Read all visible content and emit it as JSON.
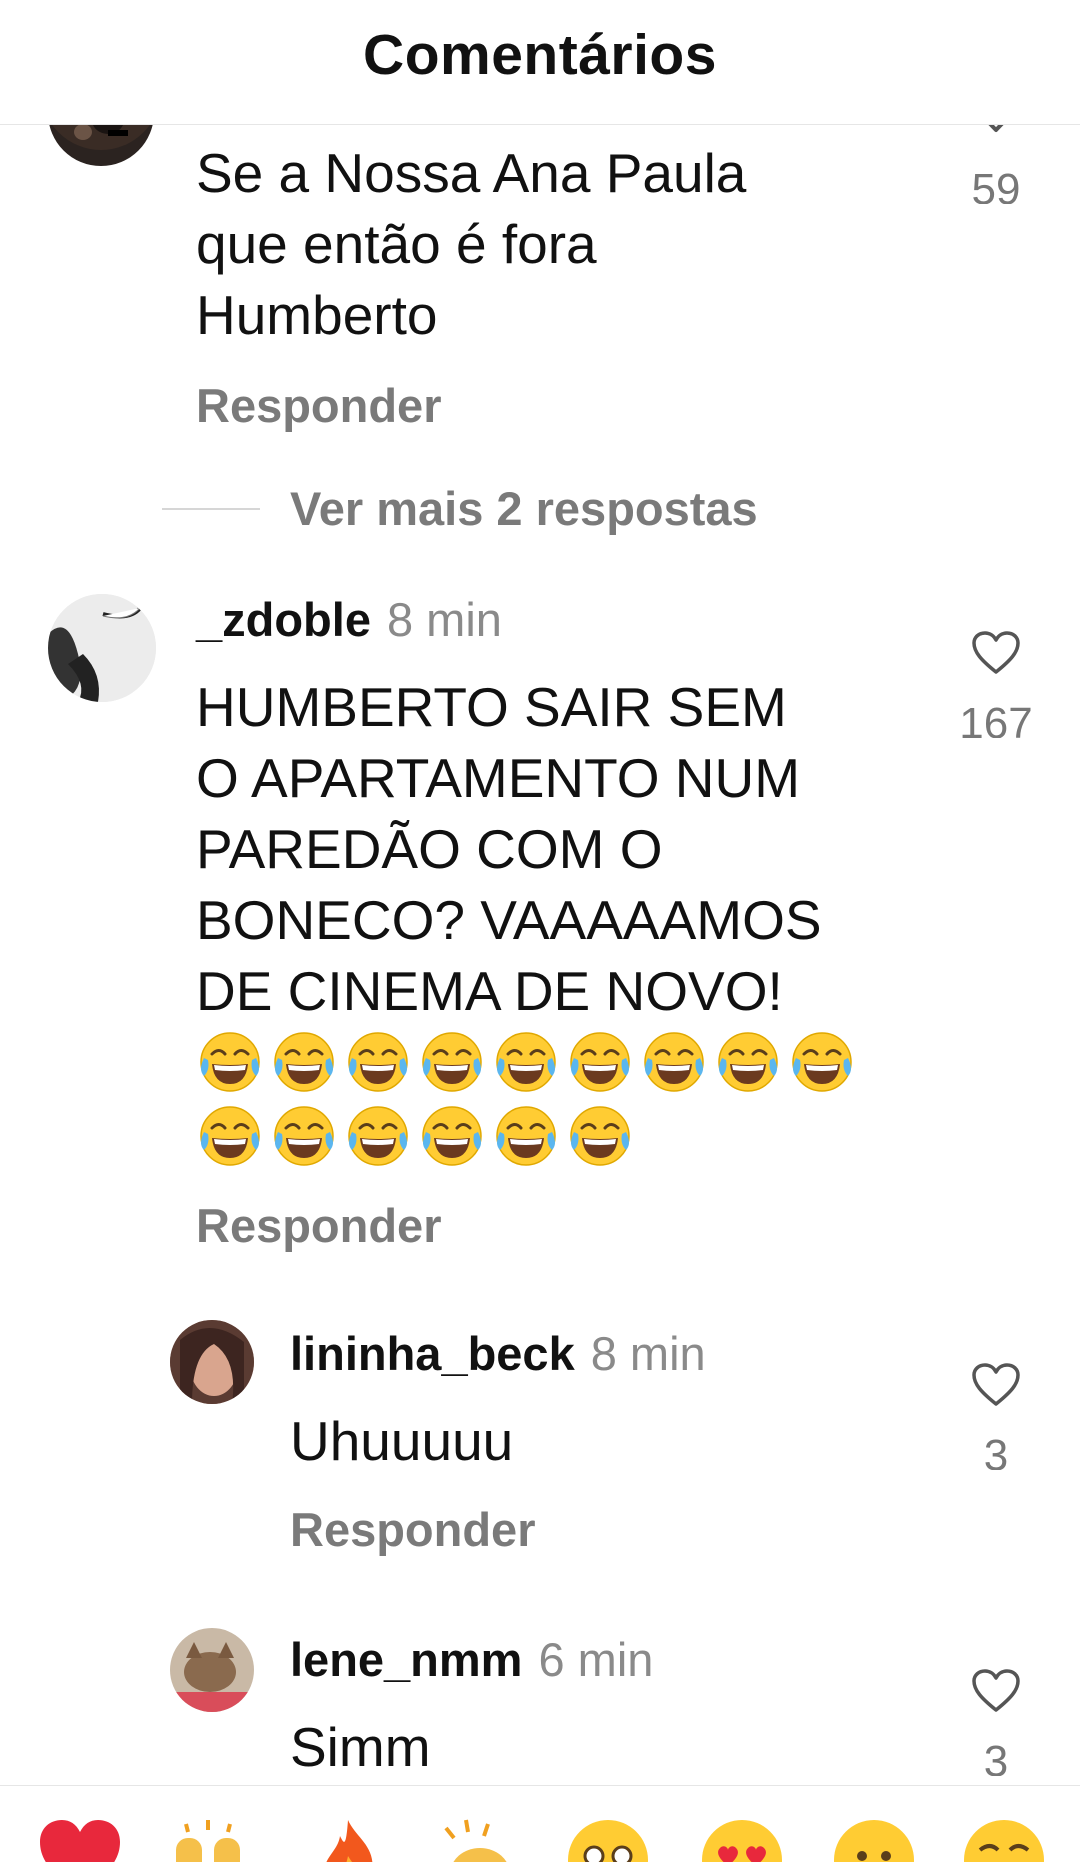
{
  "header": {
    "title": "Comentários"
  },
  "comments": [
    {
      "text_lines": [
        "Se a Nossa Ana Paula",
        "que então é fora",
        "Humberto"
      ],
      "likes": "59",
      "reply_label": "Responder"
    },
    {
      "username": "_zdoble",
      "time": "8 min",
      "text_lines": [
        "HUMBERTO SAIR SEM",
        "O APARTAMENTO NUM",
        "PAREDÃO COM O",
        "BONECO? VAAAAAMOS",
        "DE CINEMA DE NOVO!"
      ],
      "emoji_rows": [
        9,
        6
      ],
      "emoji_name": "face-with-tears-of-joy",
      "likes": "167",
      "reply_label": "Responder"
    },
    {
      "username": "lininha_beck",
      "time": "8 min",
      "text": "Uhuuuuu",
      "likes": "3",
      "reply_label": "Responder"
    },
    {
      "username": "lene_nmm",
      "time": "6 min",
      "text": "Simm",
      "likes": "3"
    }
  ],
  "more_replies": {
    "label": "Ver mais 2 respostas"
  },
  "emoji_bar": [
    "red-heart",
    "raising-hands",
    "fire",
    "clapping-hands",
    "pleading-face",
    "heart-eyes-face",
    "surprised-face",
    "tears-of-joy-face"
  ],
  "colors": {
    "secondary_text": "#7a7a7a",
    "divider": "#e6e6e6",
    "heart_red": "#e8283c",
    "emoji_yellow": "#ffcc33"
  }
}
